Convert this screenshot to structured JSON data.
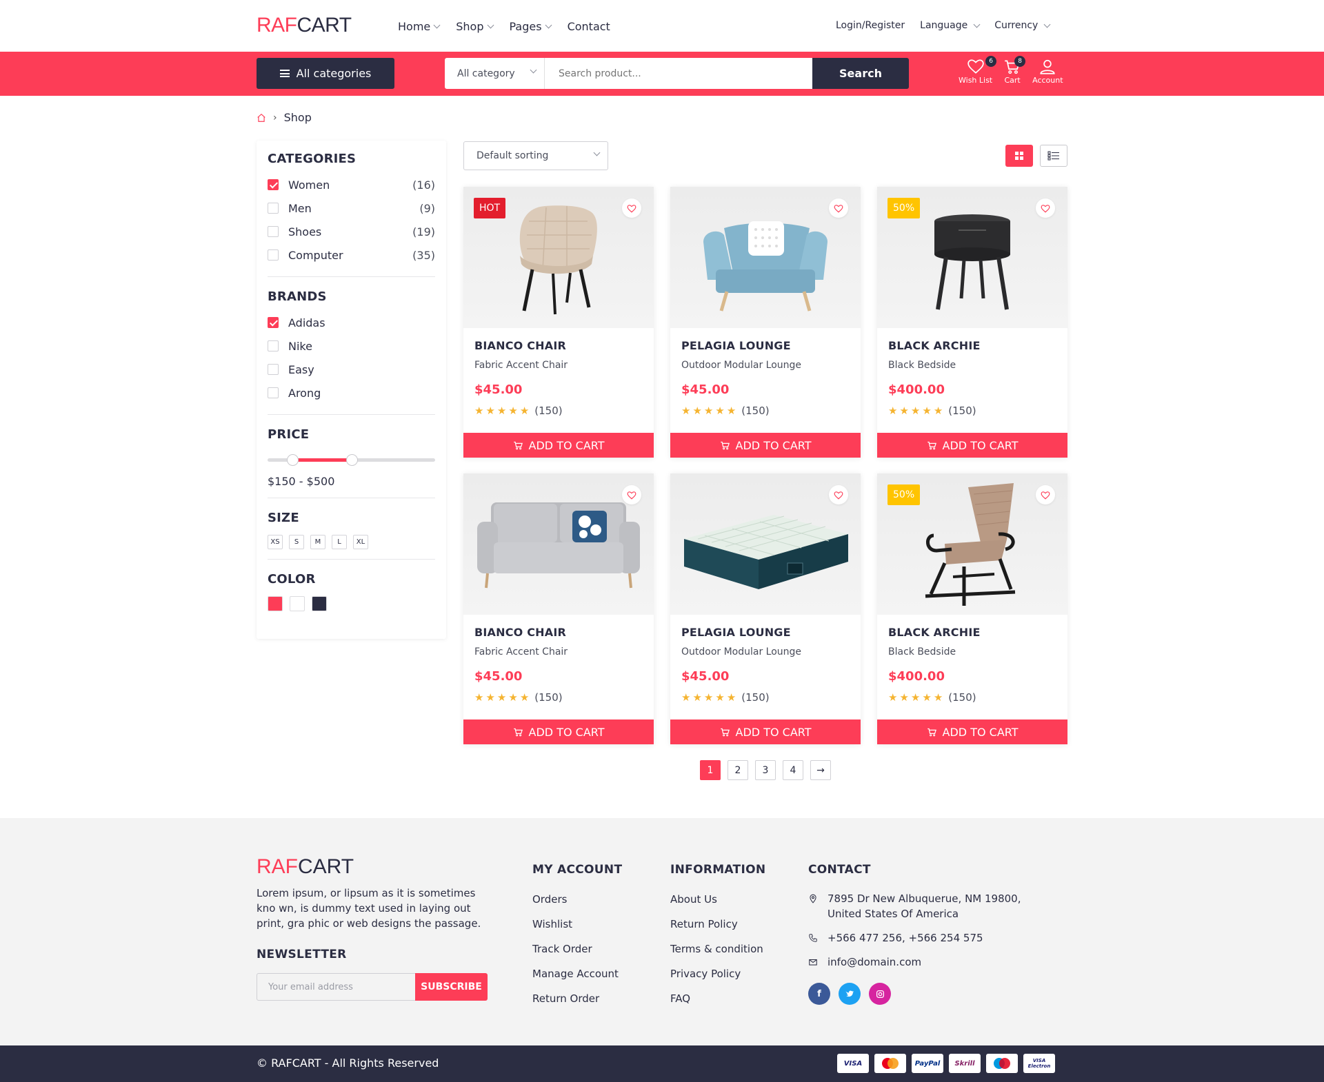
{
  "header": {
    "logo_a": "RAF",
    "logo_b": "CART",
    "nav": [
      "Home",
      "Shop",
      "Pages",
      "Contact"
    ],
    "login": "Login/Register",
    "language": "Language",
    "currency": "Currency"
  },
  "bar": {
    "all_categories": "All categories",
    "category_select": "All category",
    "search_placeholder": "Search product...",
    "search_button": "Search",
    "wishlist_label": "Wish List",
    "wishlist_count": "6",
    "cart_label": "Cart",
    "cart_count": "8",
    "account_label": "Account"
  },
  "breadcrumb": {
    "current": "Shop"
  },
  "sidebar": {
    "categories_title": "CATEGORIES",
    "categories": [
      {
        "label": "Women",
        "count": "(16)",
        "checked": true
      },
      {
        "label": "Men",
        "count": "(9)",
        "checked": false
      },
      {
        "label": "Shoes",
        "count": "(19)",
        "checked": false
      },
      {
        "label": "Computer",
        "count": "(35)",
        "checked": false
      }
    ],
    "brands_title": "BRANDS",
    "brands": [
      {
        "label": "Adidas",
        "checked": true
      },
      {
        "label": "Nike",
        "checked": false
      },
      {
        "label": "Easy",
        "checked": false
      },
      {
        "label": "Arong",
        "checked": false
      }
    ],
    "price_title": "PRICE",
    "price_range": "$150 - $500",
    "price_min_fraction": 0.15,
    "price_max_fraction": 0.5,
    "size_title": "SIZE",
    "sizes": [
      "XS",
      "S",
      "M",
      "L",
      "XL"
    ],
    "color_title": "COLOR",
    "colors": [
      "#fd3d57",
      "#ffffff",
      "#2b2d42"
    ]
  },
  "toolbar": {
    "sort": "Default sorting"
  },
  "products": [
    {
      "tag": "HOT",
      "tag_type": "hot",
      "name": "BIANCO CHAIR",
      "sub": "Fabric Accent Chair",
      "price": "$45.00",
      "rating": 5,
      "reviews": "(150)",
      "image": "accent-chair"
    },
    {
      "tag": "",
      "tag_type": "",
      "name": "PELAGIA LOUNGE",
      "sub": "Outdoor Modular Lounge",
      "price": "$45.00",
      "rating": 5,
      "reviews": "(150)",
      "image": "blue-armchair"
    },
    {
      "tag": "50%",
      "tag_type": "sale",
      "name": "BLACK ARCHIE",
      "sub": "Black Bedside",
      "price": "$400.00",
      "rating": 5,
      "reviews": "(150)",
      "image": "black-bedside"
    },
    {
      "tag": "",
      "tag_type": "",
      "name": "BIANCO CHAIR",
      "sub": "Fabric Accent Chair",
      "price": "$45.00",
      "rating": 5,
      "reviews": "(150)",
      "image": "grey-sofa"
    },
    {
      "tag": "",
      "tag_type": "",
      "name": "PELAGIA LOUNGE",
      "sub": "Outdoor Modular Lounge",
      "price": "$45.00",
      "rating": 5,
      "reviews": "(150)",
      "image": "air-mattress"
    },
    {
      "tag": "50%",
      "tag_type": "sale",
      "name": "BLACK ARCHIE",
      "sub": "Black Bedside",
      "price": "$400.00",
      "rating": 5,
      "reviews": "(150)",
      "image": "glider-chair"
    }
  ],
  "add_to_cart": "ADD TO CART",
  "pagination": {
    "pages": [
      "1",
      "2",
      "3",
      "4"
    ],
    "active": "1",
    "next": "→"
  },
  "footer": {
    "logo_a": "RAF",
    "logo_b": "CART",
    "desc": "Lorem ipsum, or lipsum as it is sometimes kno wn, is dummy text used in laying out print, gra phic or web designs the passage.",
    "newsletter_title": "NEWSLETTER",
    "email_placeholder": "Your email address",
    "subscribe": "SUBSCRIBE",
    "account_title": "MY ACCOUNT",
    "account_links": [
      "Orders",
      "Wishlist",
      "Track Order",
      "Manage Account",
      "Return Order"
    ],
    "info_title": "INFORMATION",
    "info_links": [
      "About Us",
      "Return Policy",
      "Terms & condition",
      "Privacy Policy",
      "FAQ"
    ],
    "contact_title": "CONTACT",
    "address_1": "7895 Dr New Albuquerue, NM 19800,",
    "address_2": "United States Of America",
    "phone": "+566 477 256, +566 254 575",
    "email": "info@domain.com",
    "social": [
      "facebook",
      "twitter",
      "instagram"
    ],
    "copyright": "© RAFCART - All Rights Reserved",
    "payments": [
      "VISA",
      "mastercard",
      "PayPal",
      "Skrill",
      "maestro",
      "VISA Electron"
    ]
  },
  "colors": {
    "accent": "#fd3d57",
    "dark": "#2b2d42",
    "star": "#f5b431",
    "sale": "#ffc400",
    "hot": "#e31e2d"
  }
}
